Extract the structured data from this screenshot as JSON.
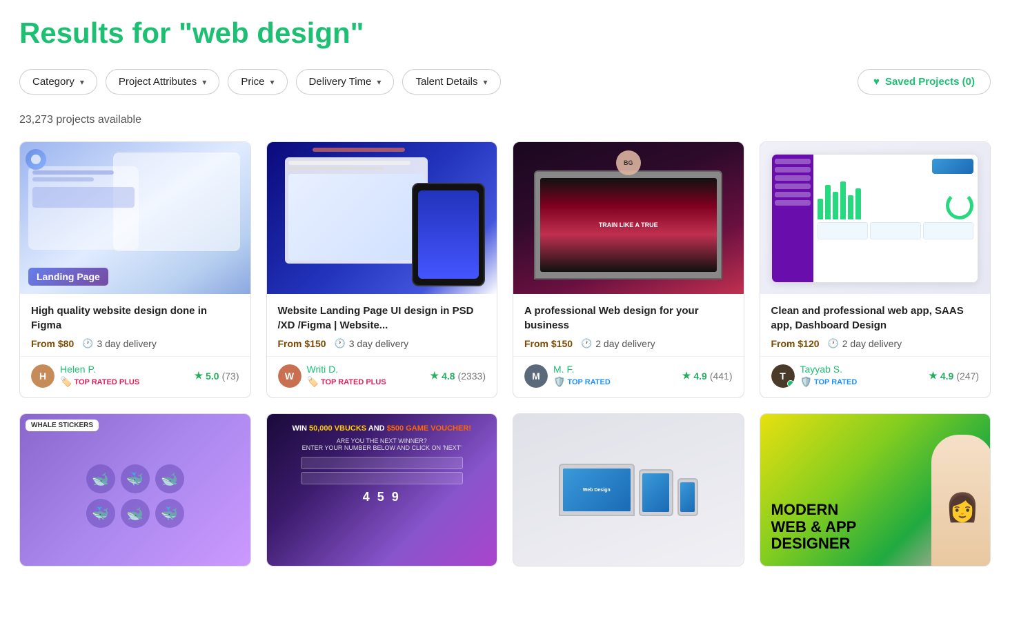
{
  "page": {
    "title": "Results for \"web design\""
  },
  "filters": {
    "category_label": "Category",
    "project_attributes_label": "Project Attributes",
    "price_label": "Price",
    "delivery_time_label": "Delivery Time",
    "talent_details_label": "Talent Details",
    "saved_projects_label": "Saved Projects (0)"
  },
  "results": {
    "count_text": "23,273 projects available"
  },
  "cards": [
    {
      "title": "High quality website design done in Figma",
      "price": "From $80",
      "delivery": "3 day delivery",
      "seller_name": "Helen P.",
      "seller_initial": "H",
      "seller_color": "#c78b5a",
      "rating_score": "5.0",
      "rating_count": "(73)",
      "badge_type": "top_rated_plus",
      "badge_label": "TOP RATED PLUS",
      "has_online": false
    },
    {
      "title": "Website Landing Page UI design in PSD /XD /Figma | Website...",
      "price": "From $150",
      "delivery": "3 day delivery",
      "seller_name": "Writi D.",
      "seller_initial": "W",
      "seller_color": "#c87050",
      "rating_score": "4.8",
      "rating_count": "(2333)",
      "badge_type": "top_rated_plus",
      "badge_label": "TOP RATED PLUS",
      "has_online": false
    },
    {
      "title": "A professional Web design for your business",
      "price": "From $150",
      "delivery": "2 day delivery",
      "seller_name": "M. F.",
      "seller_initial": "M",
      "seller_color": "#5a6a7a",
      "rating_score": "4.9",
      "rating_count": "(441)",
      "badge_type": "top_rated",
      "badge_label": "TOP RATED",
      "has_online": false
    },
    {
      "title": "Clean and professional web app, SAAS app, Dashboard Design",
      "price": "From $120",
      "delivery": "2 day delivery",
      "seller_name": "Tayyab S.",
      "seller_initial": "T",
      "seller_color": "#4a3a2a",
      "rating_score": "4.9",
      "rating_count": "(247)",
      "badge_type": "top_rated",
      "badge_label": "TOP RATED",
      "has_online": true
    }
  ]
}
